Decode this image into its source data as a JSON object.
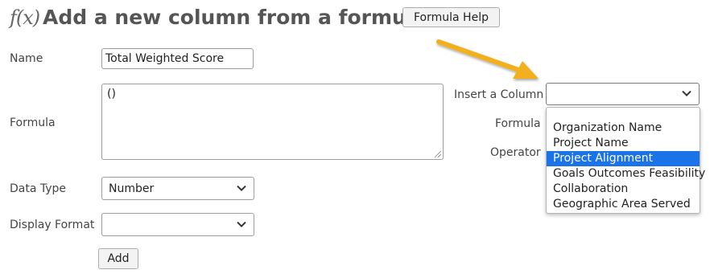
{
  "header": {
    "fx_symbol": "f(x)",
    "title": "Add a new column from a formula.",
    "help_button_label": "Formula Help"
  },
  "form": {
    "name_label": "Name",
    "name_value": "Total Weighted Score",
    "formula_label": "Formula",
    "formula_value": "()",
    "data_type_label": "Data Type",
    "data_type_value": "Number",
    "display_format_label": "Display Format",
    "display_format_value": "",
    "add_button_label": "Add"
  },
  "insert": {
    "column_label": "Insert a Column",
    "column_value": "",
    "formula_label": "Formula",
    "operator_label": "Operator",
    "options": [
      "",
      "Organization Name",
      "Project Name",
      "Project Alignment",
      "Goals Outcomes Feasibility",
      "Collaboration",
      "Geographic Area Served"
    ],
    "highlighted_option": "Project Alignment"
  },
  "colors": {
    "highlight": "#1a73e8",
    "arrow": "#f2b01e"
  }
}
